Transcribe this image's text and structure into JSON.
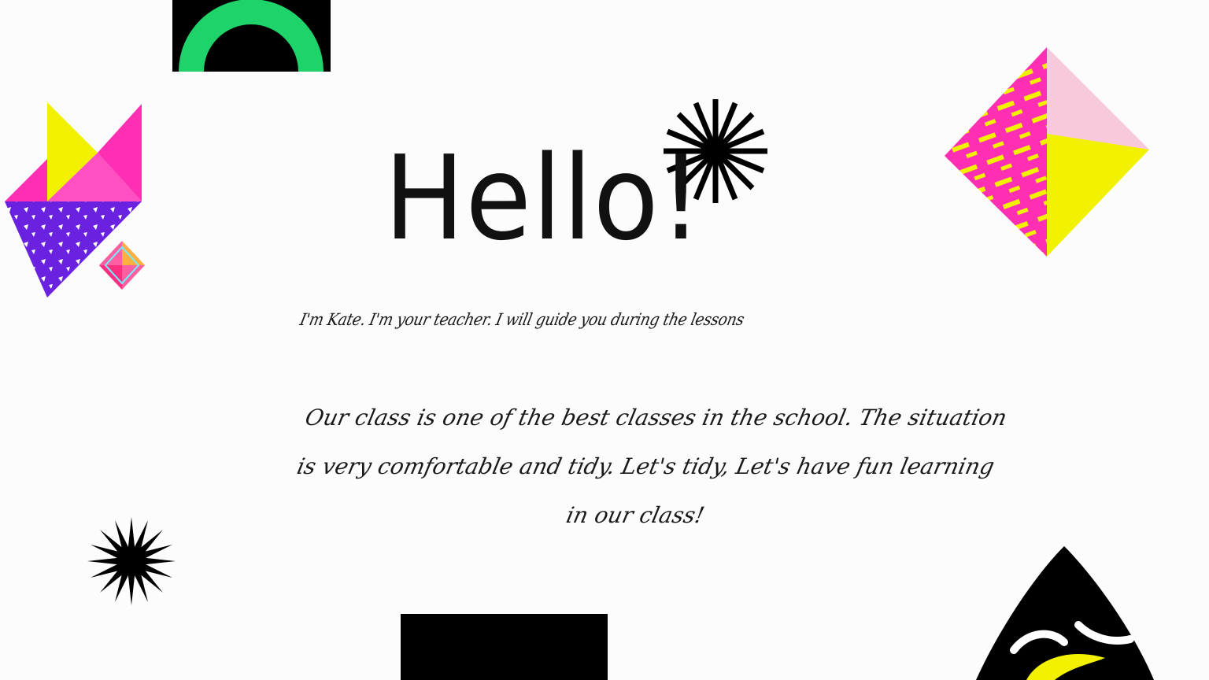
{
  "slide": {
    "title": "Hello!",
    "intro": "I'm Kate. I'm your teacher. I will guide you during the lessons",
    "body": "Our class is one of the best classes in the school. The situation is very comfortable and tidy. Let's tidy, Let's have fun learning in our class!"
  },
  "colors": {
    "background": "#fdfcfc",
    "green": "#1ed36a",
    "magenta": "#ff2fb4",
    "yellow": "#f2f200",
    "purple": "#6a22e0",
    "pink_light": "#f8c8dc",
    "black": "#000000"
  },
  "decorations": [
    "green-arch-icon",
    "starburst-icon",
    "tangram-fox-icon",
    "small-diamond-icon",
    "pattern-diamond-icon",
    "small-starburst-icon",
    "black-rectangle",
    "black-cone-face-icon"
  ]
}
